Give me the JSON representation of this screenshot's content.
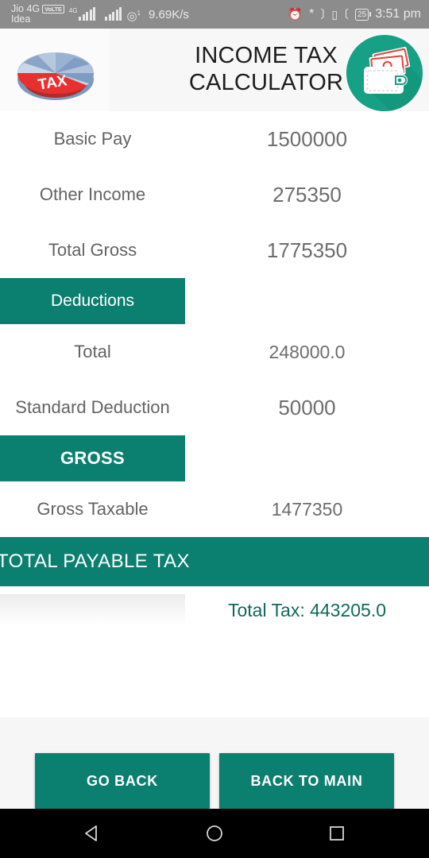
{
  "status_bar": {
    "carrier_primary": "Jio 4G",
    "volte_badge": "VoLTE",
    "carrier_secondary": "Idea",
    "network_type": "4G",
    "wifi_superscript": "1",
    "network_speed": "9.69K/s",
    "alarm_icon": "alarm-icon",
    "bluetooth_icon": "bluetooth-icon",
    "vibrate_icon": "vibrate-icon",
    "battery_level": "25",
    "time": "3:51 pm",
    "background_color": "#8c8c8c"
  },
  "header": {
    "logo_icon": "tax-pie-chart-logo",
    "logo_label": "TAX",
    "title_line1": "INCOME TAX",
    "title_line2": "CALCULATOR",
    "app_icon": "wallet-money-icon",
    "app_icon_color": "#16a085"
  },
  "theme": {
    "accent": "#0b7f70",
    "value_text": "#6d6d6d",
    "label_text": "#636363",
    "total_tax_text": "#0d6a5d",
    "panel_bg": "#f6f6f6"
  },
  "income": {
    "rows": [
      {
        "label": "Basic Pay",
        "value": "1500000"
      },
      {
        "label": "Other Income",
        "value": "275350"
      },
      {
        "label": "Total Gross",
        "value": "1775350"
      }
    ]
  },
  "deductions": {
    "section_title": "Deductions",
    "rows": [
      {
        "label": "Total",
        "value": "248000.0"
      },
      {
        "label": "Standard Deduction",
        "value": "50000"
      }
    ]
  },
  "gross": {
    "section_title": "GROSS",
    "rows": [
      {
        "label": "Gross Taxable",
        "value": "1477350"
      }
    ]
  },
  "payable": {
    "banner_title": "TOTAL PAYABLE TAX",
    "total_tax_text": "Total Tax: 443205.0"
  },
  "actions": {
    "go_back_label": "GO BACK",
    "back_to_main_label": "BACK TO MAIN"
  },
  "navigation": {
    "back_icon": "back-triangle-icon",
    "home_icon": "home-circle-icon",
    "recents_icon": "recents-square-icon"
  }
}
